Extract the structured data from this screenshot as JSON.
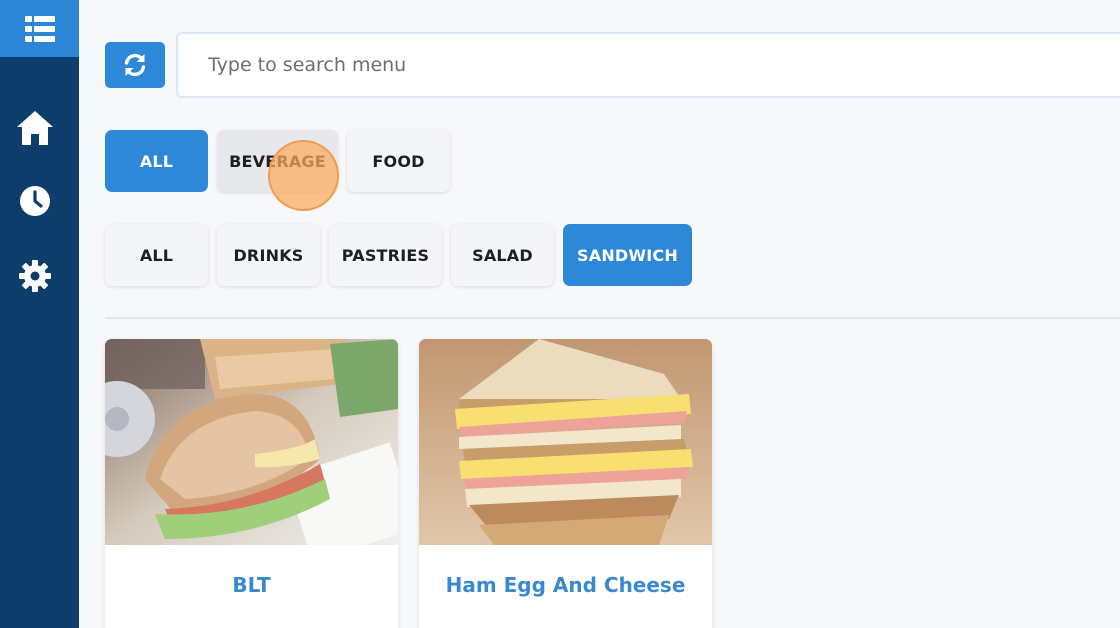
{
  "sidebar": {
    "menu_icon": "list-icon",
    "items": [
      {
        "icon": "home-icon"
      },
      {
        "icon": "clock-icon"
      },
      {
        "icon": "gear-icon"
      }
    ]
  },
  "toolbar": {
    "refresh_icon": "refresh-icon",
    "search_placeholder": "Type to search menu"
  },
  "categories": [
    {
      "label": "ALL",
      "active": true
    },
    {
      "label": "BEVERAGE",
      "active": false
    },
    {
      "label": "FOOD",
      "active": false
    }
  ],
  "subcategories": [
    {
      "label": "ALL",
      "active": false
    },
    {
      "label": "DRINKS",
      "active": false
    },
    {
      "label": "PASTRIES",
      "active": false
    },
    {
      "label": "SALAD",
      "active": false
    },
    {
      "label": "SANDWICH",
      "active": true
    }
  ],
  "products": [
    {
      "name": "BLT"
    },
    {
      "name": "Ham Egg And Cheese"
    }
  ],
  "colors": {
    "sidebar": "#0d3e6b",
    "accent": "#2e88d8",
    "product_name": "#3a89d0"
  }
}
